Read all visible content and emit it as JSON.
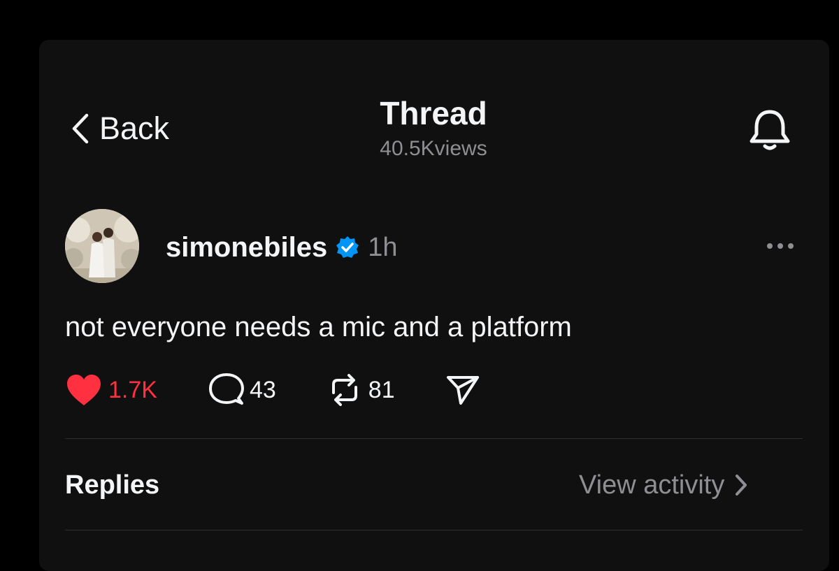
{
  "header": {
    "back_label": "Back",
    "title": "Thread",
    "views": "40.5Kviews",
    "back_icon": "chevron-left-icon",
    "notify_icon": "bell-icon"
  },
  "post": {
    "username": "simonebiles",
    "verified": true,
    "time": "1h",
    "text": "not everyone needs a mic and a platform",
    "liked": true,
    "likes": "1.7K",
    "replies_count": "43",
    "reposts": "81",
    "colors": {
      "like": "#ff3040",
      "verified": "#0095f6"
    }
  },
  "replies_section": {
    "title": "Replies",
    "view_activity_label": "View activity"
  }
}
